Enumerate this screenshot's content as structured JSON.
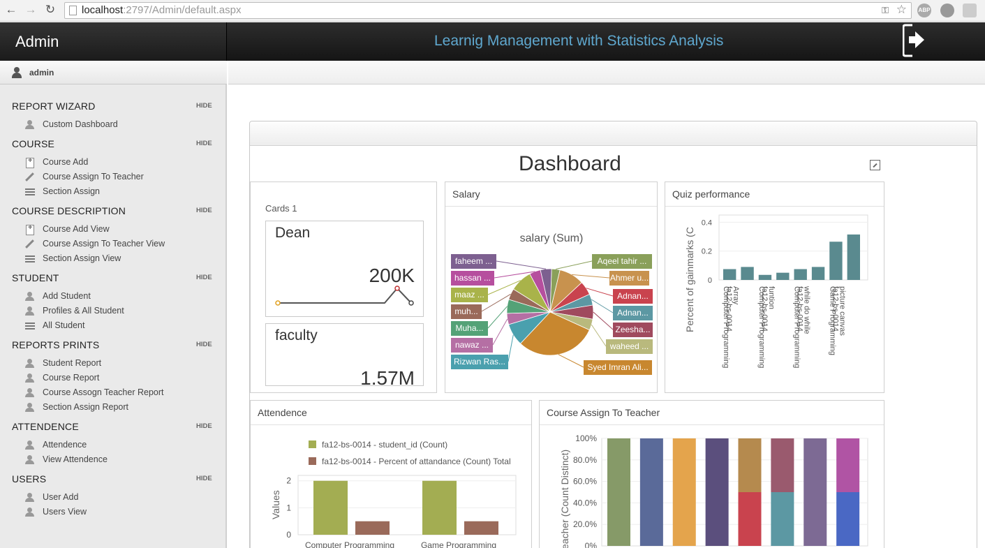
{
  "browser": {
    "url_host": "localhost",
    "url_path": ":2797/Admin/default.aspx",
    "ext_abp": "ABP"
  },
  "header": {
    "brand": "Admin",
    "app_title": "Learnig Management with Statistics Analysis"
  },
  "user": {
    "name": "admin"
  },
  "sidebar": {
    "hide_label": "HIDE",
    "sections": [
      {
        "title": "REPORT WIZARD",
        "items": [
          {
            "label": "Custom Dashboard",
            "icon": "user-icon"
          }
        ]
      },
      {
        "title": "COURSE",
        "items": [
          {
            "label": "Course Add",
            "icon": "add-icon"
          },
          {
            "label": "Course Assign To Teacher",
            "icon": "pencil-icon"
          },
          {
            "label": "Section Assign",
            "icon": "list-icon"
          }
        ]
      },
      {
        "title": "COURSE DESCRIPTION",
        "items": [
          {
            "label": "Course Add View",
            "icon": "add-icon"
          },
          {
            "label": "Course Assign To Teacher View",
            "icon": "pencil-icon"
          },
          {
            "label": "Section Assign View",
            "icon": "list-icon"
          }
        ]
      },
      {
        "title": "STUDENT",
        "items": [
          {
            "label": "Add Student",
            "icon": "user-icon"
          },
          {
            "label": "Profiles & All Student",
            "icon": "users-icon"
          },
          {
            "label": "All Student",
            "icon": "list-icon"
          }
        ]
      },
      {
        "title": "REPORTS PRINTS",
        "items": [
          {
            "label": "Student Report",
            "icon": "user-icon"
          },
          {
            "label": "Course Report",
            "icon": "user-icon"
          },
          {
            "label": "Course Assogn Teacher Report",
            "icon": "user-icon"
          },
          {
            "label": "Section Assign Report",
            "icon": "user-icon"
          }
        ]
      },
      {
        "title": "ATTENDENCE",
        "items": [
          {
            "label": "Attendence",
            "icon": "user-icon"
          },
          {
            "label": "View Attendence",
            "icon": "user-icon"
          }
        ]
      },
      {
        "title": "USERS",
        "items": [
          {
            "label": "User Add",
            "icon": "user-icon"
          },
          {
            "label": "Users View",
            "icon": "user-icon"
          }
        ]
      }
    ]
  },
  "dashboard": {
    "title": "Dashboard",
    "cards": {
      "panel_caption": "Cards 1",
      "items": [
        {
          "label": "Dean",
          "value": "200K"
        },
        {
          "label": "faculty",
          "value": "1.57M"
        }
      ]
    },
    "salary_panel": "Salary",
    "quiz_panel": "Quiz performance",
    "attendence_panel": "Attendence",
    "course_assign_panel": "Course Assign To Teacher"
  },
  "chart_data": [
    {
      "type": "line",
      "title": "Dean",
      "values": [
        0,
        0,
        0,
        0,
        0,
        0,
        0,
        1,
        0
      ],
      "note_max": "200K"
    },
    {
      "type": "pie",
      "title": "salary (Sum)",
      "labels": [
        "Aqeel tahir ...",
        "Ahmer u...",
        "Adnan...",
        "Adnan...",
        "Zeesha...",
        "waheed ...",
        "Syed Imran Ali...",
        "Rizwan Ras...",
        "nawaz ...",
        "Muha...",
        "muh...",
        "maaz ...",
        "hassan ...",
        "faheem ..."
      ],
      "values": [
        3,
        9,
        5,
        4,
        5,
        4,
        29,
        8,
        4,
        5,
        4,
        8,
        4,
        4
      ],
      "colors": [
        "#8aa05a",
        "#c8924e",
        "#c9434e",
        "#5c98a3",
        "#a04a5e",
        "#b9b97d",
        "#c8872f",
        "#4aa0ae",
        "#b56fa4",
        "#54a277",
        "#9a6a5a",
        "#a9b34a",
        "#b64f9e",
        "#7d6090"
      ]
    },
    {
      "type": "bar",
      "ylabel": "Percent of gainmarks (C",
      "ylim": [
        0,
        0.45
      ],
      "yticks": [
        "0",
        "0.2",
        "0.4"
      ],
      "categories": [
        "fa12-bs-0014 Array Computer Programming",
        "fa12-bs-0014 funtion Computer Programming",
        "fa12-bs-0014 while do while Computer Programming",
        "fa12-bs-0014 picture canvas Game Programming"
      ],
      "category_lines": [
        [
          "fa12-bs-0014",
          "Array",
          "Computer Programming"
        ],
        [
          "fa12-bs-0014",
          "funtion",
          "Computer Programming"
        ],
        [
          "fa12-bs-0014",
          "while do while",
          "Computer Programming"
        ],
        [
          "fa12-bs-0014",
          "picture canvas",
          "Game Programming"
        ]
      ],
      "values": [
        0.075,
        0.09,
        0.035,
        0.05,
        0.075,
        0.09,
        0.265,
        0.315
      ],
      "color": "#5a8a8f"
    },
    {
      "type": "bar",
      "ylabel": "Values",
      "ylim": [
        0,
        2.2
      ],
      "yticks": [
        "0",
        "1",
        "2"
      ],
      "categories": [
        "Computer Programming",
        "Game Programming"
      ],
      "series": [
        {
          "name": "fa12-bs-0014 - student_id (Count)",
          "values": [
            2,
            2
          ],
          "color": "#a3ad52"
        },
        {
          "name": "fa12-bs-0014 - Percent of attandance (Count) Total",
          "values": [
            0.5,
            0.5
          ],
          "color": "#9a6a5a"
        }
      ]
    },
    {
      "type": "bar",
      "stacked": true,
      "ylabel": "eacher (Count Distinct)",
      "ylim": [
        0,
        1
      ],
      "yticks": [
        "0%",
        "20.0%",
        "40.0%",
        "60.0%",
        "80.0%",
        "100%"
      ],
      "columns": [
        [
          {
            "value": 1.0,
            "color": "#869a68"
          }
        ],
        [
          {
            "value": 1.0,
            "color": "#5a6a99"
          }
        ],
        [
          {
            "value": 1.0,
            "color": "#e4a44c"
          }
        ],
        [
          {
            "value": 1.0,
            "color": "#5b4f7d"
          }
        ],
        [
          {
            "value": 0.5,
            "color": "#c9434e"
          },
          {
            "value": 0.5,
            "color": "#b58a4e"
          }
        ],
        [
          {
            "value": 0.5,
            "color": "#5c98a3"
          },
          {
            "value": 0.5,
            "color": "#9a5a6e"
          }
        ],
        [
          {
            "value": 1.0,
            "color": "#7d6a94"
          }
        ],
        [
          {
            "value": 0.5,
            "color": "#4a68c4"
          },
          {
            "value": 0.5,
            "color": "#b054a4"
          }
        ]
      ]
    }
  ]
}
